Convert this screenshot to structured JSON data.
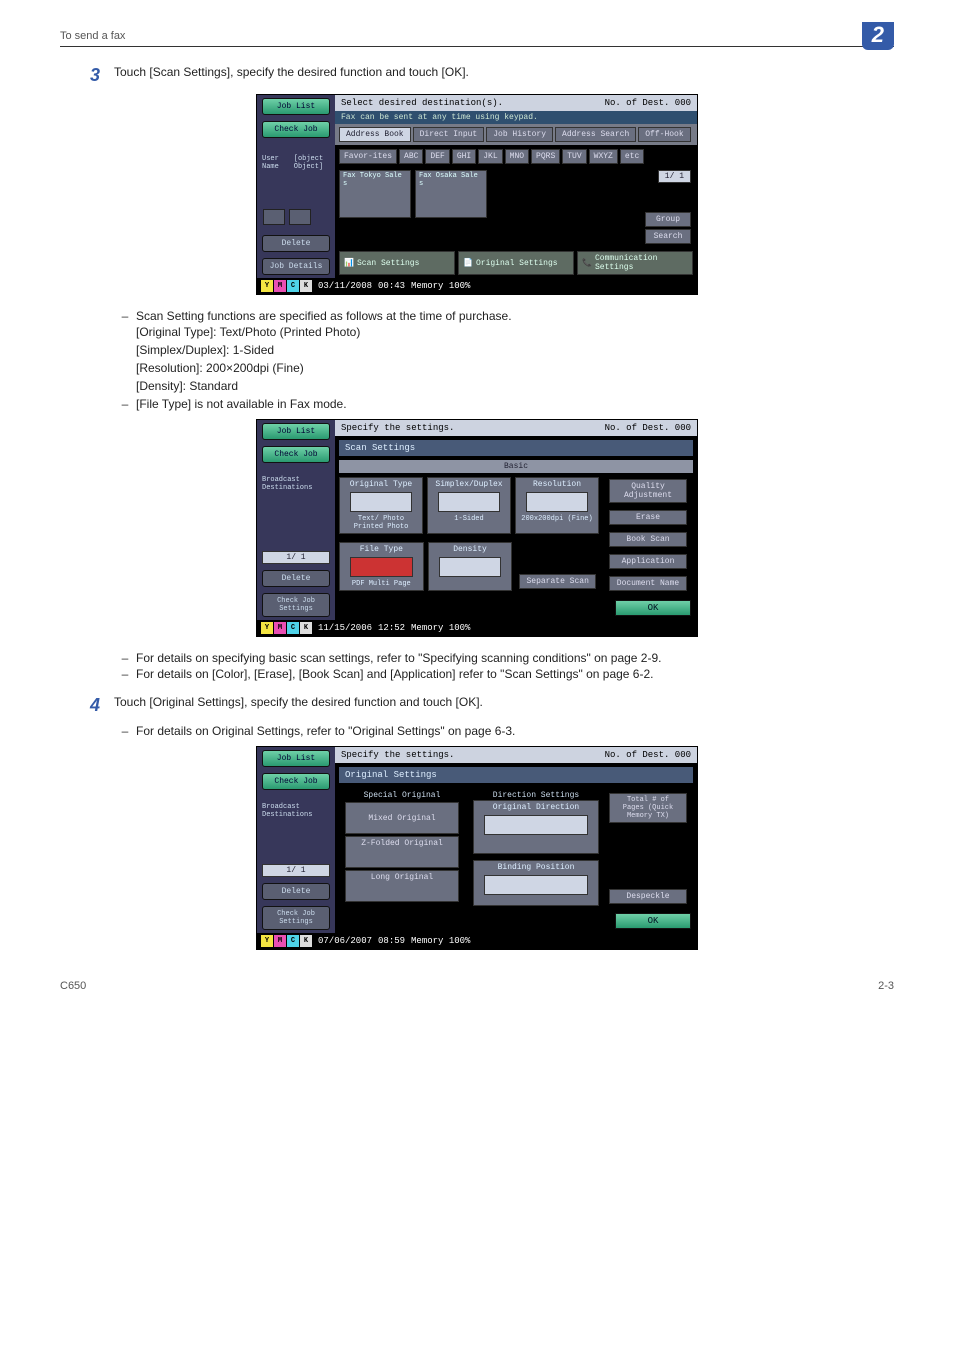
{
  "header": {
    "running": "To send a fax",
    "chapter": "2"
  },
  "steps": {
    "s3": {
      "num": "3",
      "text": "Touch [Scan Settings], specify the desired function and touch [OK]."
    },
    "s3_notes": {
      "lead": "Scan Setting functions are specified as follows at the time of purchase.",
      "l1": "[Original Type]: Text/Photo (Printed Photo)",
      "l2": "[Simplex/Duplex]: 1-Sided",
      "l3": "[Resolution]: 200×200dpi (Fine)",
      "l4": "[Density]: Standard",
      "filetype": "[File Type] is not available in Fax mode."
    },
    "s3_post": {
      "a": "For details on specifying basic scan settings, refer to \"Specifying scanning conditions\" on page 2-9.",
      "b": "For details on [Color], [Erase], [Book Scan] and [Application] refer to \"Scan Settings\" on page 6-2."
    },
    "s4": {
      "num": "4",
      "text": "Touch [Original Settings], specify the desired function and touch [OK]."
    },
    "s4_notes": {
      "a": "For details on Original Settings, refer to \"Original Settings\" on page 6-3."
    }
  },
  "scr1": {
    "job_list": "Job List",
    "check_job": "Check Job",
    "user_name": "User Name",
    "status": {
      "date": "03/11/2008",
      "time": "00:43",
      "mem": "Memory   100%"
    },
    "delete": "Delete",
    "job_details": "Job Details",
    "title": "Select desired destination(s).",
    "dest_count": "No. of Dest.   000",
    "hint": "Fax can be sent at any time using keypad.",
    "tabs": {
      "address_book": "Address Book",
      "direct_input": "Direct Input",
      "job_history": "Job History",
      "address_search": "Address Search",
      "off_hook": "Off-Hook"
    },
    "keys": {
      "favorites": "Favor-ites",
      "abc": "ABC",
      "def": "DEF",
      "ghi": "GHI",
      "jkl": "JKL",
      "mno": "MNO",
      "pqrs": "PQRS",
      "tuv": "TUV",
      "wxyz": "WXYZ",
      "etc": "etc"
    },
    "cards": {
      "c1": "Fax\nTokyo Sale\ns",
      "c2": "Fax\nOsaka Sale\ns",
      "pager": "1/ 1"
    },
    "side": {
      "group": "Group",
      "search": "Search"
    },
    "bottom": {
      "scan": "Scan Settings",
      "orig": "Original Settings",
      "comm": "Communication Settings"
    }
  },
  "scr2": {
    "job_list": "Job List",
    "check_job": "Check Job",
    "bd": "Broadcast Destinations",
    "pager": "1/ 1",
    "delete": "Delete",
    "cjs": "Check Job Settings",
    "title": "Specify the settings.",
    "dest_count": "No. of Dest.   000",
    "panel": "Scan Settings",
    "basic": "Basic",
    "cells": {
      "orig_type": "Original Type",
      "orig_type_val": "Text/ Photo Printed Photo",
      "sd": "Simplex/Duplex",
      "sd_val": "1-Sided",
      "res": "Resolution",
      "res_val": "200x200dpi (Fine)",
      "ft": "File Type",
      "ft_val": "PDF Multi Page",
      "den": "Density",
      "sep": "Separate Scan"
    },
    "right": {
      "qa": "Quality Adjustment",
      "erase": "Erase",
      "bs": "Book Scan",
      "app": "Application",
      "dn": "Document Name"
    },
    "ok": "OK",
    "status": {
      "date": "11/15/2006",
      "time": "12:52",
      "mem": "Memory   100%"
    }
  },
  "scr3": {
    "job_list": "Job List",
    "check_job": "Check Job",
    "bd": "Broadcast Destinations",
    "pager": "1/ 1",
    "delete": "Delete",
    "cjs": "Check Job Settings",
    "title": "Specify the settings.",
    "dest_count": "No. of Dest.   000",
    "panel": "Original Settings",
    "labels": {
      "special": "Special Original",
      "mixed": "Mixed Original",
      "zfold": "Z-Folded Original",
      "long": "Long Original",
      "dirset": "Direction Settings",
      "odir": "Original Direction",
      "bpos": "Binding Position",
      "pages": "Total # of Pages (Quick Memory TX)",
      "despeckle": "Despeckle"
    },
    "ok": "OK",
    "status": {
      "date": "07/06/2007",
      "time": "08:59",
      "mem": "Memory   100%"
    }
  },
  "footer": {
    "model": "C650",
    "page": "2-3"
  }
}
